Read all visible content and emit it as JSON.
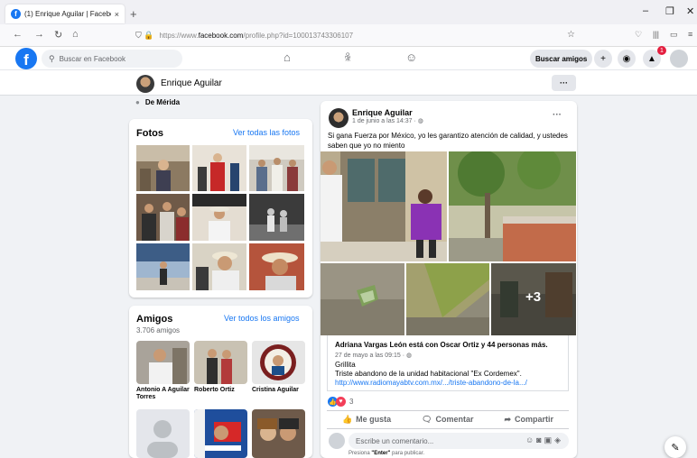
{
  "browser": {
    "tab_title": "(1) Enrique Aguilar | Facebook",
    "tab_close": "×",
    "new_tab": "+",
    "url_host": "https://www.",
    "url_domain": "facebook.com",
    "url_path": "/profile.php?id=100013743306107",
    "win_min": "–",
    "win_max": "❐",
    "win_close": "✕"
  },
  "fb_header": {
    "logo": "f",
    "search_placeholder": "Buscar en Facebook",
    "find_friends": "Buscar amigos",
    "notif_count": "1"
  },
  "profile": {
    "name": "Enrique Aguilar",
    "more": "···",
    "location": "De Mérida"
  },
  "photos": {
    "title": "Fotos",
    "see_all": "Ver todas las fotos"
  },
  "friends": {
    "title": "Amigos",
    "count": "3.706 amigos",
    "see_all": "Ver todos los amigos",
    "items": [
      {
        "name": "Antonio A Aguilar Torres"
      },
      {
        "name": "Roberto Ortiz"
      },
      {
        "name": "Cristina Aguilar"
      }
    ]
  },
  "post": {
    "author": "Enrique Aguilar",
    "date": "1 de junio a las 14:37 · ",
    "more": "···",
    "text": "Si gana Fuerza por México, yo les garantizo atención de calidad, y ustedes saben que yo no miento",
    "more_photos": "+3",
    "shared": {
      "title": "Adriana Vargas León está con Oscar Ortiz y 44 personas más.",
      "date": "27 de mayo a las 09:15 · ",
      "line1": "Grillita",
      "line2": "Triste abandono de la unidad habitacional \"Ex Cordemex\".",
      "link": "http://www.radiomayabtv.com.mx/.../triste-abandono-de-la.../"
    },
    "reaction_count": "3",
    "like": "Me gusta",
    "comment": "Comentar",
    "share": "Compartir",
    "comment_placeholder": "Escribe un comentario...",
    "hint_pre": "Presiona ",
    "hint_key": "\"Enter\"",
    "hint_post": " para publicar."
  },
  "icons": {
    "back": "←",
    "forward": "→",
    "reload": "↻",
    "home": "⌂",
    "bookmark": "☆",
    "home_nav": "⌂",
    "friends_nav": "👥",
    "groups_nav": "☺",
    "plus": "+",
    "messenger": "●",
    "bell": "🔔",
    "compose": "✎"
  },
  "colors": {
    "brand": "#1877f2",
    "badge": "#e41e3f",
    "love": "#f33e58"
  }
}
